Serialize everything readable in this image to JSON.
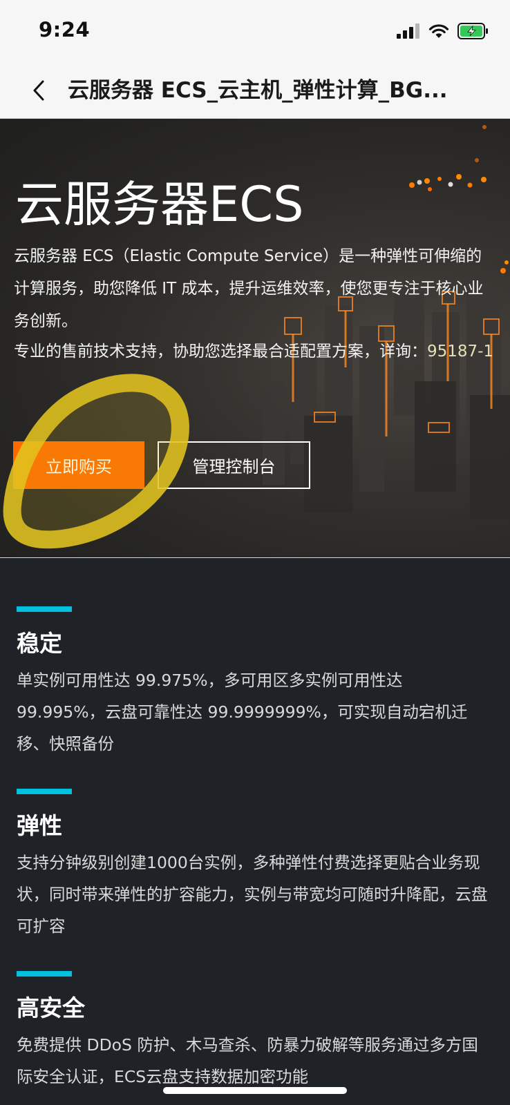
{
  "status_bar": {
    "time": "9:24"
  },
  "nav": {
    "title": "云服务器 ECS_云主机_弹性计算_BG..."
  },
  "hero": {
    "title": "云服务器ECS",
    "description": "云服务器 ECS（Elastic Compute Service）是一种弹性可伸缩的计算服务，助您降低 IT 成本，提升运维效率，使您更专注于核心业务创新。",
    "contact_prefix": "专业的售前技术支持，协助您选择最合适配置方案，详询：",
    "contact_phone": "95187-1",
    "buy_label": "立即购买",
    "console_label": "管理控制台"
  },
  "features": [
    {
      "title": "稳定",
      "text": "单实例可用性达 99.975%，多可用区多实例可用性达 99.995%，云盘可靠性达 99.9999999%，可实现自动宕机迁移、快照备份"
    },
    {
      "title": "弹性",
      "text": "支持分钟级别创建1000台实例，多种弹性付费选择更贴合业务现状，同时带来弹性的扩容能力，实例与带宽均可随时升降配，云盘可扩容"
    },
    {
      "title": "高安全",
      "text": "免费提供 DDoS 防护、木马查杀、防暴力破解等服务通过多方国际安全认证，ECS云盘支持数据加密功能"
    }
  ],
  "colors": {
    "accent_orange": "#ff6a00",
    "feature_bar_cyan": "#00c1de",
    "page_background": "#1f2227",
    "annotation_yellow": "#e3c41f"
  },
  "icons": {
    "back": "chevron-left-icon",
    "signal": "cellular-signal-icon",
    "wifi": "wifi-icon",
    "battery": "battery-charging-icon"
  }
}
